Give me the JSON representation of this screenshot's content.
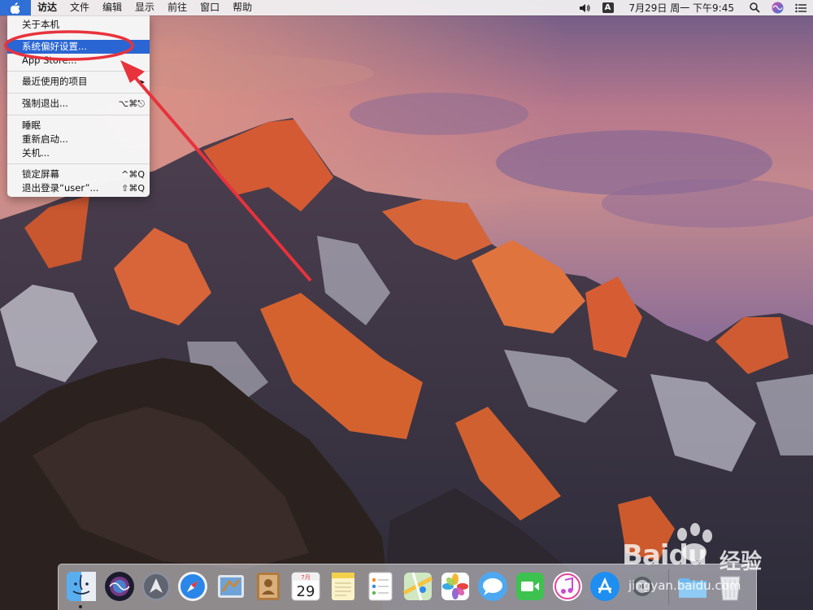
{
  "menubar": {
    "apple_icon": "apple-icon",
    "items": [
      "访达",
      "文件",
      "编辑",
      "显示",
      "前往",
      "窗口",
      "帮助"
    ],
    "input_source": "A",
    "clock": "7月29日 周一 下午9:45",
    "status_icons": [
      "volume-icon",
      "input-source-icon",
      "search-icon",
      "siri-icon",
      "notification-center-icon"
    ]
  },
  "apple_menu": {
    "about": "关于本机",
    "system_prefs": "系统偏好设置...",
    "app_store": "App Store...",
    "recent_items": "最近使用的项目",
    "force_quit": "强制退出...",
    "force_quit_shortcut": "⌥⌘⎋",
    "sleep": "睡眠",
    "restart": "重新启动...",
    "shutdown": "关机...",
    "lock_screen": "锁定屏幕",
    "lock_shortcut": "^⌘Q",
    "logout": "退出登录“user”...",
    "logout_shortcut": "⇧⌘Q"
  },
  "dock": {
    "apps": [
      "finder-icon",
      "siri-icon",
      "launchpad-icon",
      "safari-icon",
      "mail-icon",
      "contacts-icon",
      "calendar-icon",
      "notes-icon",
      "reminders-icon",
      "maps-icon",
      "photos-icon",
      "messages-icon",
      "facetime-icon",
      "itunes-icon",
      "app-store-icon",
      "system-preferences-icon",
      "downloads-folder-icon",
      "trash-icon"
    ],
    "calendar_month": "7月",
    "calendar_day": "29"
  },
  "watermark": {
    "brand": "Baidu",
    "label": "经验",
    "url": "jingyan.baidu.com"
  },
  "colors": {
    "selection": "#2a66d3",
    "annotation": "#e8323c"
  }
}
